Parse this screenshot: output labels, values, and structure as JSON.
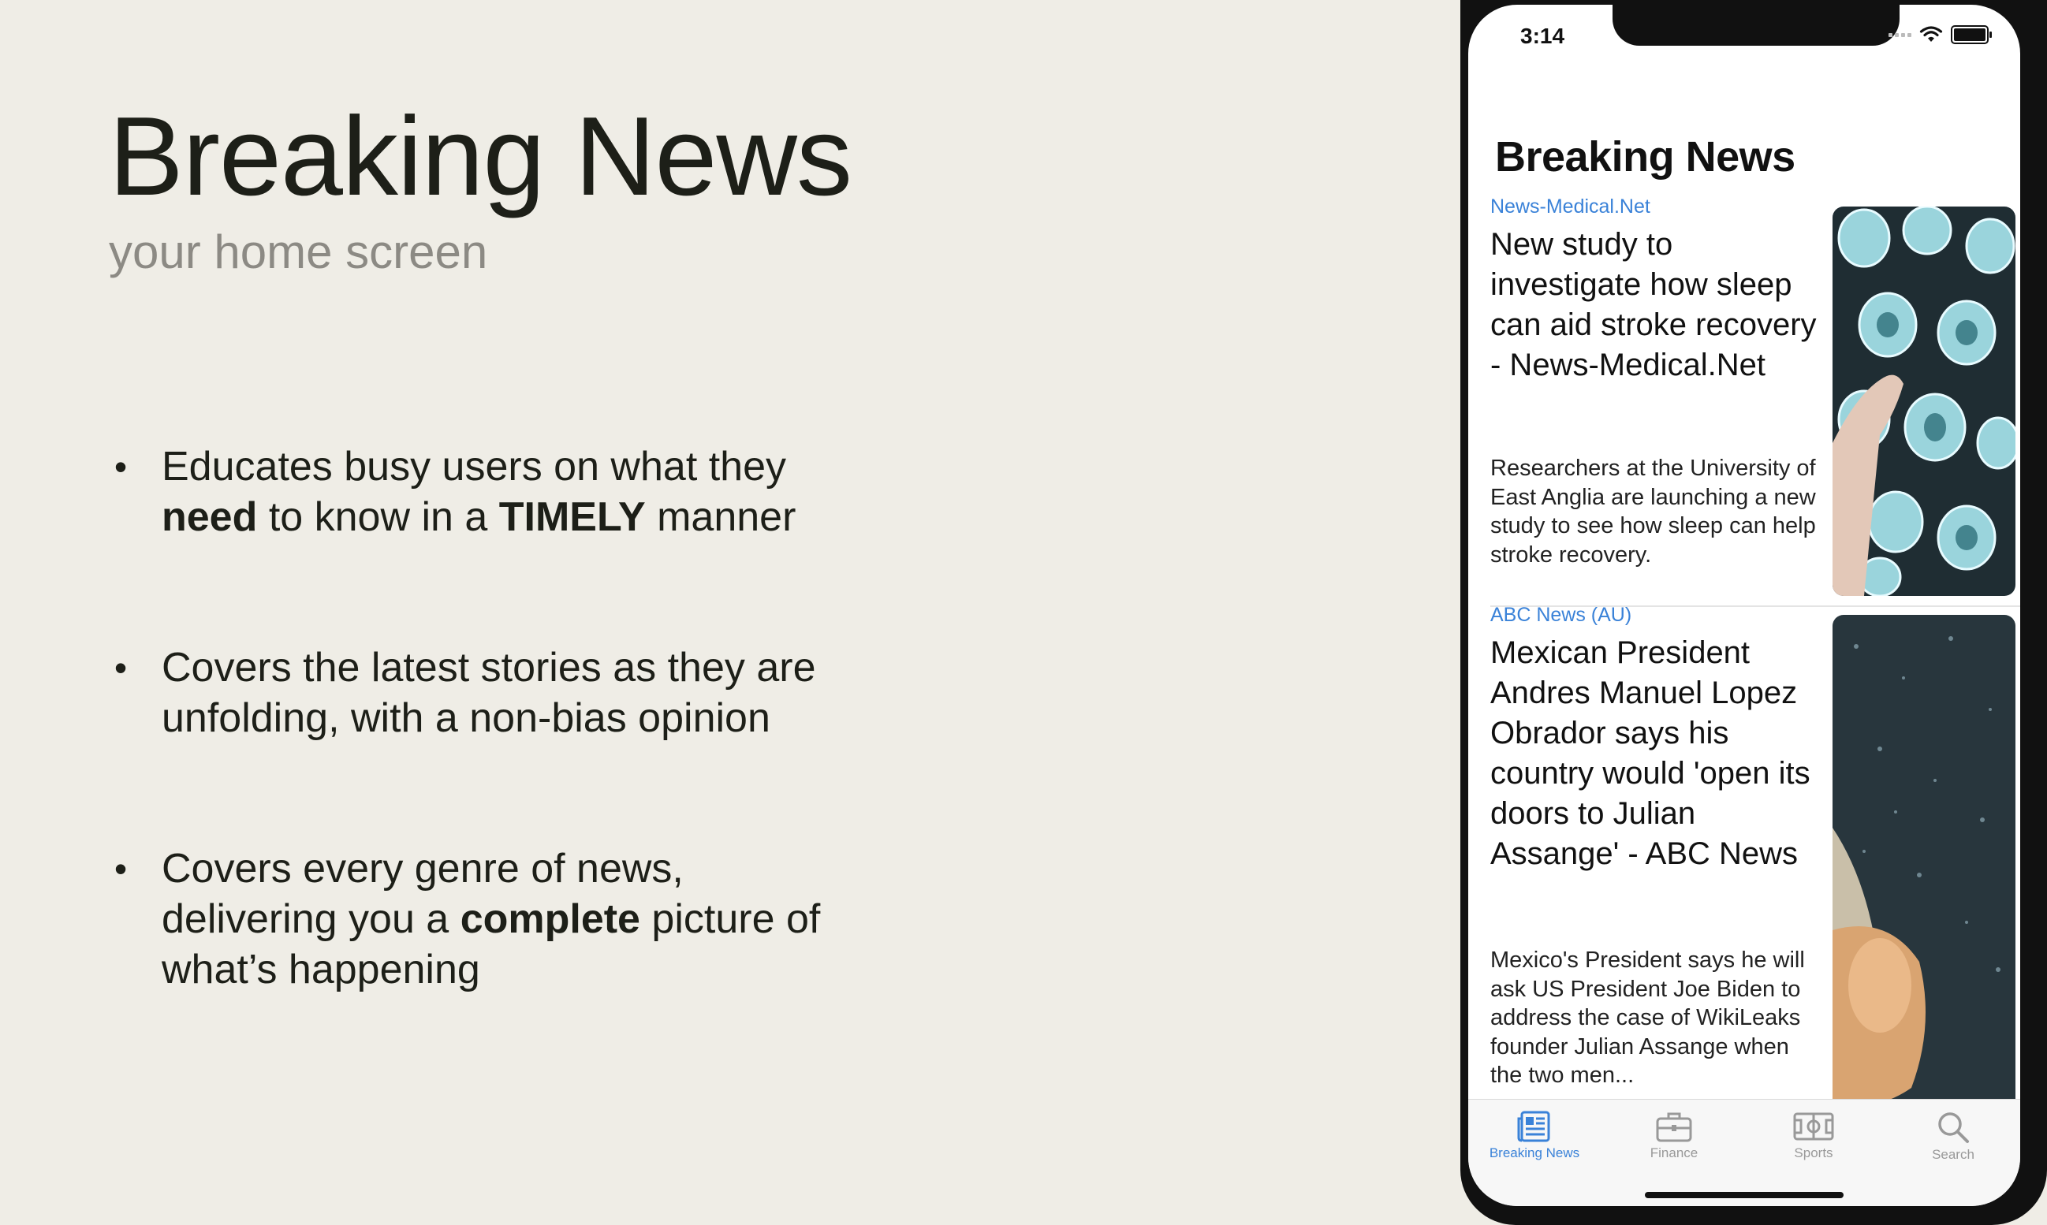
{
  "slide": {
    "title": "Breaking News",
    "subtitle": "your home screen",
    "bullets": [
      {
        "pre1": "Educates busy users on what they",
        "bold1": "need",
        "mid": " to know in a ",
        "bold2": "TIMELY",
        "post": " manner"
      },
      {
        "line1": "Covers the latest stories as they are",
        "line2": "unfolding, with a non-bias opinion"
      },
      {
        "line1": "Covers every genre of news,",
        "pre2": "delivering you a ",
        "bold": "complete",
        "post2": " picture of",
        "line3": "what’s happening"
      }
    ],
    "bullet_glyph": "•"
  },
  "phone": {
    "status": {
      "time": "3:14"
    },
    "app_title": "Breaking News",
    "articles": [
      {
        "source": "News-Medical.Net",
        "headline": "New study to investigate how sleep can aid stroke recovery - News-Medical.Net",
        "description": "Researchers at the University of East Anglia are launching a new study to see how sleep can help stroke recovery."
      },
      {
        "source": "ABC News (AU)",
        "headline": "Mexican President Andres Manuel Lopez Obrador says his country would 'open its doors to Julian Assange' - ABC News",
        "description": "Mexico's President says he will ask US President Joe Biden to address the case of WikiLeaks founder Julian Assange when the two men..."
      }
    ],
    "tabs": [
      {
        "label": "Breaking News",
        "icon": "newspaper-icon",
        "active": true
      },
      {
        "label": "Finance",
        "icon": "briefcase-icon",
        "active": false
      },
      {
        "label": "Sports",
        "icon": "field-icon",
        "active": false
      },
      {
        "label": "Search",
        "icon": "search-icon",
        "active": false
      }
    ],
    "colors": {
      "accent": "#3a82d8",
      "inactive": "#999999"
    }
  }
}
